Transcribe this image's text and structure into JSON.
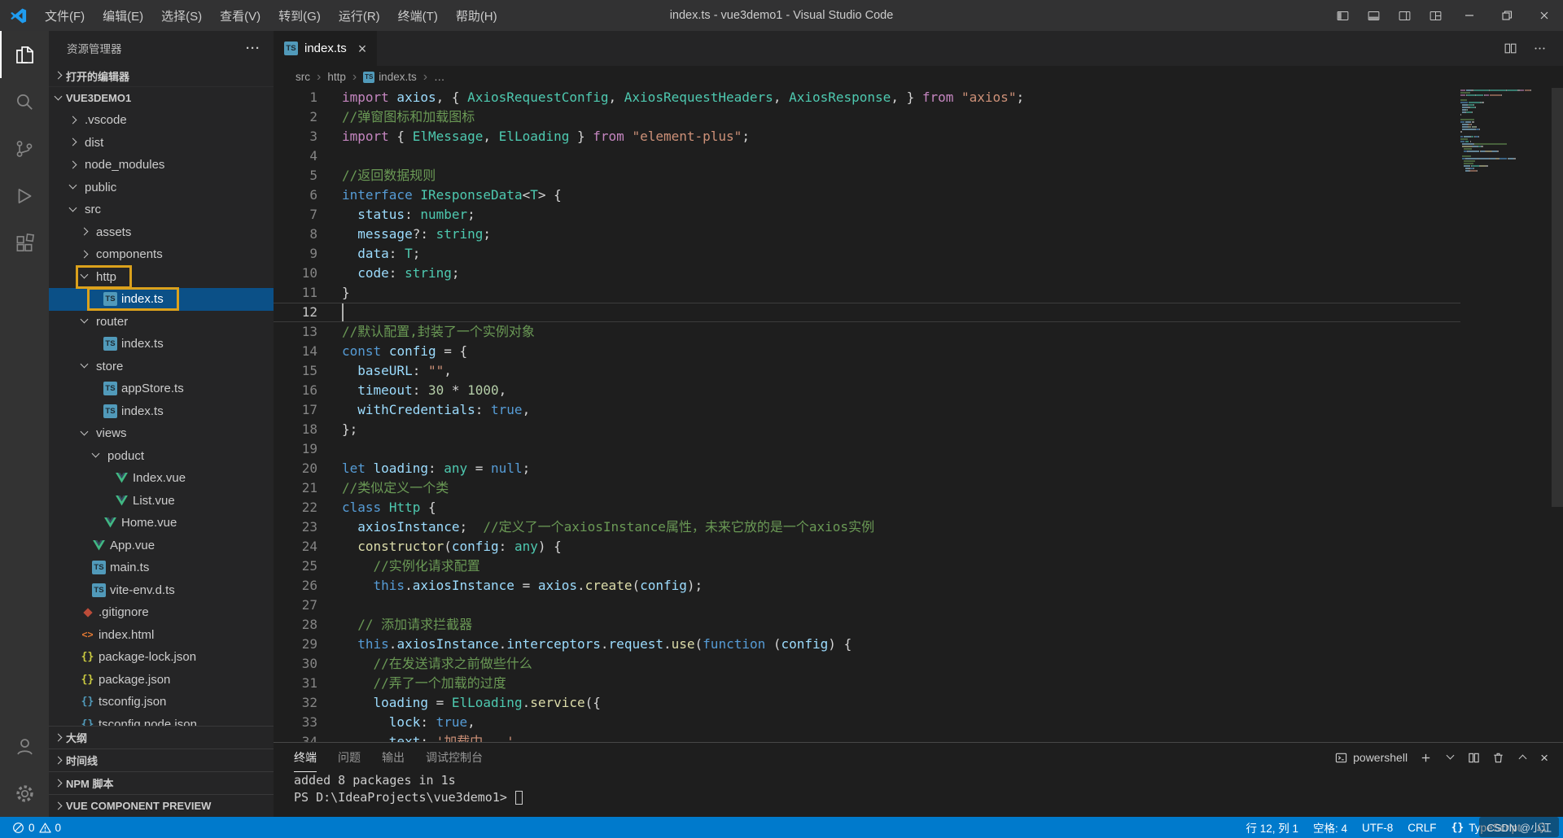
{
  "colors": {
    "accent": "#007acc",
    "selection": "#0b5087",
    "annotation_box": "#dba11c",
    "editor_bg": "#1e1e1e",
    "sidebar_bg": "#252526",
    "activitybar_bg": "#333333",
    "titlebar_bg": "#323233"
  },
  "title_bar": {
    "title": "index.ts - vue3demo1 - Visual Studio Code",
    "menus": [
      "文件(F)",
      "编辑(E)",
      "选择(S)",
      "查看(V)",
      "转到(G)",
      "运行(R)",
      "终端(T)",
      "帮助(H)"
    ]
  },
  "sidebar": {
    "title": "资源管理器",
    "more_label": "···",
    "open_editors_label": "打开的编辑器",
    "project_name": "VUE3DEMO1",
    "tree": [
      {
        "label": ".vscode",
        "icon": "folder",
        "indent": 1,
        "expanded": false
      },
      {
        "label": "dist",
        "icon": "folder",
        "indent": 1,
        "expanded": false
      },
      {
        "label": "node_modules",
        "icon": "folder",
        "indent": 1,
        "expanded": false
      },
      {
        "label": "public",
        "icon": "folder",
        "indent": 1,
        "expanded": true
      },
      {
        "label": "src",
        "icon": "folder",
        "indent": 1,
        "expanded": true
      },
      {
        "label": "assets",
        "icon": "folder",
        "indent": 2,
        "expanded": false
      },
      {
        "label": "components",
        "icon": "folder",
        "indent": 2,
        "expanded": false
      },
      {
        "label": "http",
        "icon": "folder",
        "indent": 2,
        "expanded": true,
        "boxed": true
      },
      {
        "label": "index.ts",
        "icon": "ts",
        "indent": 3,
        "selected": true,
        "boxed": true
      },
      {
        "label": "router",
        "icon": "folder",
        "indent": 2,
        "expanded": true
      },
      {
        "label": "index.ts",
        "icon": "ts",
        "indent": 3
      },
      {
        "label": "store",
        "icon": "folder",
        "indent": 2,
        "expanded": true
      },
      {
        "label": "appStore.ts",
        "icon": "ts",
        "indent": 3
      },
      {
        "label": "index.ts",
        "icon": "ts",
        "indent": 3
      },
      {
        "label": "views",
        "icon": "folder",
        "indent": 2,
        "expanded": true
      },
      {
        "label": "poduct",
        "icon": "folder",
        "indent": 3,
        "expanded": true
      },
      {
        "label": "Index.vue",
        "icon": "vue",
        "indent": 4
      },
      {
        "label": "List.vue",
        "icon": "vue",
        "indent": 4
      },
      {
        "label": "Home.vue",
        "icon": "vue",
        "indent": 3
      },
      {
        "label": "App.vue",
        "icon": "vue",
        "indent": 2
      },
      {
        "label": "main.ts",
        "icon": "ts",
        "indent": 2
      },
      {
        "label": "vite-env.d.ts",
        "icon": "ts",
        "indent": 2
      },
      {
        "label": ".gitignore",
        "icon": "git",
        "indent": 1
      },
      {
        "label": "index.html",
        "icon": "html",
        "indent": 1
      },
      {
        "label": "package-lock.json",
        "icon": "json",
        "indent": 1
      },
      {
        "label": "package.json",
        "icon": "json",
        "indent": 1
      },
      {
        "label": "tsconfig.json",
        "icon": "json-blue",
        "indent": 1
      },
      {
        "label": "tsconfig.node.json",
        "icon": "json-blue",
        "indent": 1
      }
    ],
    "bottom_sections": [
      "大纲",
      "时间线",
      "NPM 脚本",
      "VUE COMPONENT PREVIEW"
    ]
  },
  "editor": {
    "tab": {
      "label": "index.ts",
      "icon": "ts"
    },
    "breadcrumbs": [
      {
        "label": "src"
      },
      {
        "label": "http"
      },
      {
        "label": "index.ts",
        "icon": "ts"
      },
      {
        "label": "…"
      }
    ],
    "cursor_line": 12,
    "code": [
      {
        "t": [
          [
            "import",
            "k"
          ],
          [
            " axios",
            "v"
          ],
          [
            ", { ",
            "p"
          ],
          [
            "AxiosRequestConfig",
            "t"
          ],
          [
            ", ",
            "p"
          ],
          [
            "AxiosRequestHeaders",
            "t"
          ],
          [
            ", ",
            "p"
          ],
          [
            "AxiosResponse",
            "t"
          ],
          [
            ", } ",
            "p"
          ],
          [
            "from",
            "k"
          ],
          [
            " ",
            "p"
          ],
          [
            "\"axios\"",
            "str"
          ],
          [
            ";",
            "p"
          ]
        ]
      },
      {
        "t": [
          [
            "//弹窗图标和加载图标",
            "c"
          ]
        ]
      },
      {
        "t": [
          [
            "import",
            "k"
          ],
          [
            " { ",
            "p"
          ],
          [
            "ElMessage",
            "t"
          ],
          [
            ", ",
            "p"
          ],
          [
            "ElLoading",
            "t"
          ],
          [
            " } ",
            "p"
          ],
          [
            "from",
            "k"
          ],
          [
            " ",
            "p"
          ],
          [
            "\"element-plus\"",
            "str"
          ],
          [
            ";",
            "p"
          ]
        ]
      },
      {
        "t": []
      },
      {
        "t": [
          [
            "//返回数据规则",
            "c"
          ]
        ]
      },
      {
        "t": [
          [
            "interface",
            "s"
          ],
          [
            " ",
            "p"
          ],
          [
            "IResponseData",
            "t"
          ],
          [
            "<",
            "p"
          ],
          [
            "T",
            "t"
          ],
          [
            "> {",
            "p"
          ]
        ]
      },
      {
        "t": [
          [
            "  status",
            "v"
          ],
          [
            ": ",
            "p"
          ],
          [
            "number",
            "t"
          ],
          [
            ";",
            "p"
          ]
        ]
      },
      {
        "t": [
          [
            "  message",
            "v"
          ],
          [
            "?: ",
            "p"
          ],
          [
            "string",
            "t"
          ],
          [
            ";",
            "p"
          ]
        ]
      },
      {
        "t": [
          [
            "  data",
            "v"
          ],
          [
            ": ",
            "p"
          ],
          [
            "T",
            "t"
          ],
          [
            ";",
            "p"
          ]
        ]
      },
      {
        "t": [
          [
            "  code",
            "v"
          ],
          [
            ": ",
            "p"
          ],
          [
            "string",
            "t"
          ],
          [
            ";",
            "p"
          ]
        ]
      },
      {
        "t": [
          [
            "}",
            "p"
          ]
        ]
      },
      {
        "t": []
      },
      {
        "t": [
          [
            "//默认配置,封装了一个实例对象",
            "c"
          ]
        ]
      },
      {
        "t": [
          [
            "const",
            "s"
          ],
          [
            " ",
            "p"
          ],
          [
            "config",
            "v"
          ],
          [
            " = {",
            "p"
          ]
        ]
      },
      {
        "t": [
          [
            "  baseURL",
            "v"
          ],
          [
            ": ",
            "p"
          ],
          [
            "\"\"",
            "str"
          ],
          [
            ",",
            "p"
          ]
        ]
      },
      {
        "t": [
          [
            "  timeout",
            "v"
          ],
          [
            ": ",
            "p"
          ],
          [
            "30",
            "n"
          ],
          [
            " * ",
            "p"
          ],
          [
            "1000",
            "n"
          ],
          [
            ",",
            "p"
          ]
        ]
      },
      {
        "t": [
          [
            "  withCredentials",
            "v"
          ],
          [
            ": ",
            "p"
          ],
          [
            "true",
            "s"
          ],
          [
            ",",
            "p"
          ]
        ]
      },
      {
        "t": [
          [
            "};",
            "p"
          ]
        ]
      },
      {
        "t": []
      },
      {
        "t": [
          [
            "let",
            "s"
          ],
          [
            " loading",
            "v"
          ],
          [
            ": ",
            "p"
          ],
          [
            "any",
            "t"
          ],
          [
            " = ",
            "p"
          ],
          [
            "null",
            "s"
          ],
          [
            ";",
            "p"
          ]
        ]
      },
      {
        "t": [
          [
            "//类似定义一个类",
            "c"
          ]
        ]
      },
      {
        "t": [
          [
            "class",
            "s"
          ],
          [
            " ",
            "p"
          ],
          [
            "Http",
            "t"
          ],
          [
            " {",
            "p"
          ]
        ]
      },
      {
        "t": [
          [
            "  axiosInstance",
            "v"
          ],
          [
            ";  ",
            "p"
          ],
          [
            "//定义了一个axiosInstance属性，未来它放的是一个axios实例",
            "c"
          ]
        ]
      },
      {
        "t": [
          [
            "  constructor",
            "f"
          ],
          [
            "(",
            "p"
          ],
          [
            "config",
            "v"
          ],
          [
            ": ",
            "p"
          ],
          [
            "any",
            "t"
          ],
          [
            ") {",
            "p"
          ]
        ]
      },
      {
        "t": [
          [
            "    //实例化请求配置",
            "c"
          ]
        ]
      },
      {
        "t": [
          [
            "    this",
            "s"
          ],
          [
            ".",
            "p"
          ],
          [
            "axiosInstance",
            "v"
          ],
          [
            " = ",
            "p"
          ],
          [
            "axios",
            "v"
          ],
          [
            ".",
            "p"
          ],
          [
            "create",
            "f"
          ],
          [
            "(",
            "p"
          ],
          [
            "config",
            "v"
          ],
          [
            ");",
            "p"
          ]
        ]
      },
      {
        "t": []
      },
      {
        "t": [
          [
            "  // 添加请求拦截器",
            "c"
          ]
        ]
      },
      {
        "t": [
          [
            "  this",
            "s"
          ],
          [
            ".",
            "p"
          ],
          [
            "axiosInstance",
            "v"
          ],
          [
            ".",
            "p"
          ],
          [
            "interceptors",
            "v"
          ],
          [
            ".",
            "p"
          ],
          [
            "request",
            "v"
          ],
          [
            ".",
            "p"
          ],
          [
            "use",
            "f"
          ],
          [
            "(",
            "p"
          ],
          [
            "function",
            "s"
          ],
          [
            " (",
            "p"
          ],
          [
            "config",
            "v"
          ],
          [
            ") {",
            "p"
          ]
        ]
      },
      {
        "t": [
          [
            "    //在发送请求之前做些什么",
            "c"
          ]
        ]
      },
      {
        "t": [
          [
            "    //弄了一个加载的过度",
            "c"
          ]
        ]
      },
      {
        "t": [
          [
            "    loading",
            "v"
          ],
          [
            " = ",
            "p"
          ],
          [
            "ElLoading",
            "t"
          ],
          [
            ".",
            "p"
          ],
          [
            "service",
            "f"
          ],
          [
            "({",
            "p"
          ]
        ]
      },
      {
        "t": [
          [
            "      lock",
            "v"
          ],
          [
            ": ",
            "p"
          ],
          [
            "true",
            "s"
          ],
          [
            ",",
            "p"
          ]
        ]
      },
      {
        "t": [
          [
            "      text",
            "v"
          ],
          [
            ": ",
            "p"
          ],
          [
            "'加载中...'",
            "str"
          ],
          [
            ",",
            "p"
          ]
        ]
      }
    ]
  },
  "terminal": {
    "tabs": [
      {
        "label": "终端",
        "active": true
      },
      {
        "label": "问题"
      },
      {
        "label": "输出"
      },
      {
        "label": "调试控制台"
      }
    ],
    "shell_label": "powershell",
    "output_line": "added 8 packages in 1s",
    "prompt_line": "PS D:\\IdeaProjects\\vue3demo1> "
  },
  "status_bar": {
    "errors": "0",
    "warnings": "0",
    "line_col": "行 12, 列 1",
    "indent": "空格: 4",
    "encoding": "UTF-8",
    "eol": "CRLF",
    "braces": "{}",
    "language": "TypeScript"
  },
  "watermark": "CSDN @小江"
}
